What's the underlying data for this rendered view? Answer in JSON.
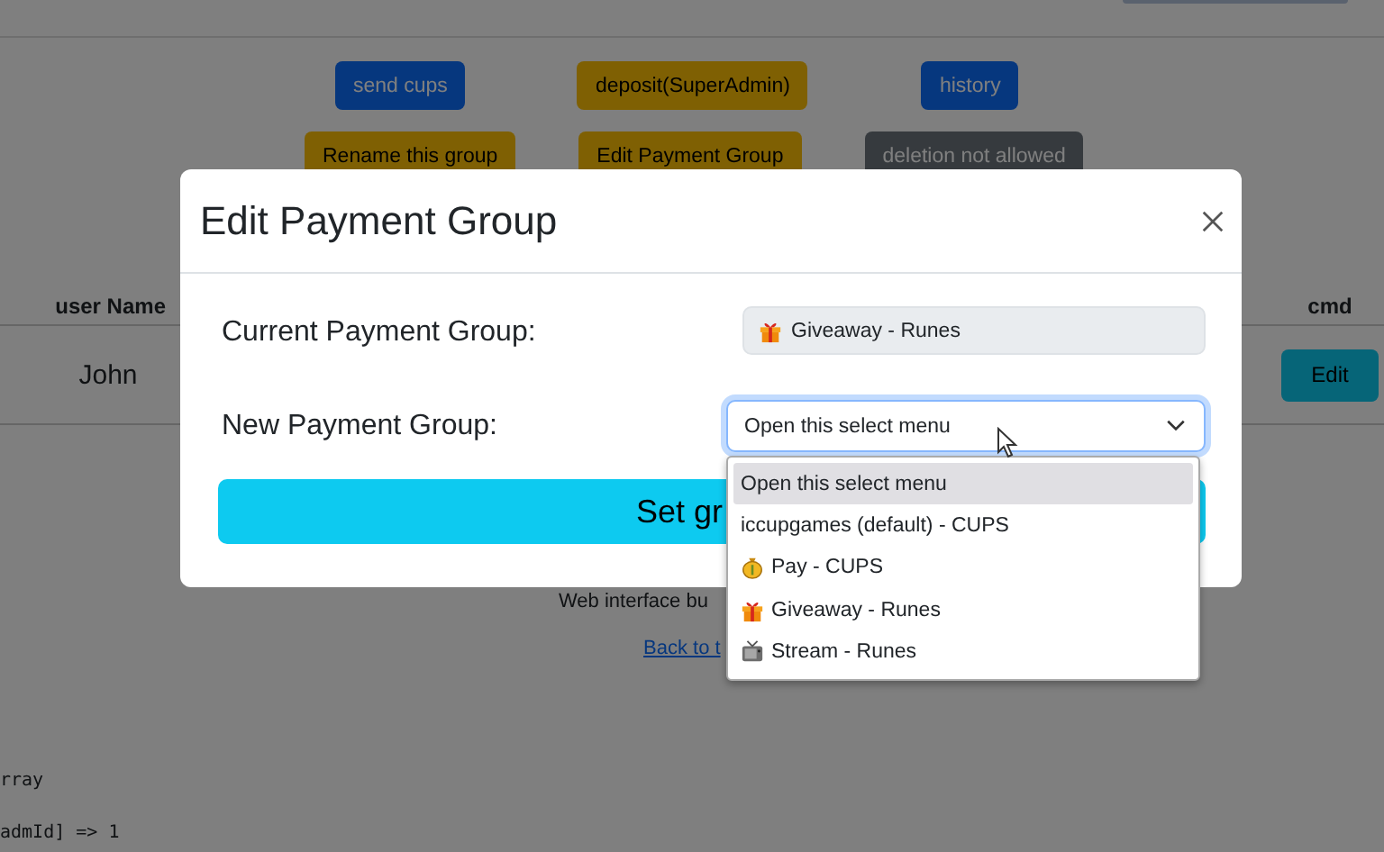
{
  "page": {
    "action_rows": [
      [
        {
          "label": "send cups",
          "kind": "primary"
        },
        {
          "label": "deposit(SuperAdmin)",
          "kind": "warning"
        },
        {
          "label": "history",
          "kind": "primary"
        }
      ],
      [
        {
          "label": "Rename this group",
          "kind": "warning"
        },
        {
          "label": "Edit Payment Group",
          "kind": "warning"
        },
        {
          "label": "deletion not allowed",
          "kind": "secondary"
        }
      ]
    ],
    "table": {
      "columns": [
        "user Name",
        "cmd"
      ],
      "rows": [
        {
          "user_name": "John",
          "cmd": "Edit"
        }
      ]
    },
    "footer": {
      "credit": "Web interface bu",
      "link": "Back to t"
    },
    "debug_lines": [
      "rray",
      "admId] => 1"
    ]
  },
  "modal": {
    "title": "Edit Payment Group",
    "current_label": "Current Payment Group:",
    "current_value": {
      "kind": "gift",
      "text": "Giveaway - Runes"
    },
    "new_label": "New Payment Group:",
    "select_value": "Open this select menu",
    "submit": "Set gr",
    "options": [
      {
        "text": "Open this select menu",
        "kind": "plain",
        "selected": true
      },
      {
        "text": "iccupgames (default) - CUPS",
        "kind": "plain",
        "selected": false
      },
      {
        "text": "Pay - CUPS",
        "kind": "money",
        "selected": false
      },
      {
        "text": "Giveaway - Runes",
        "kind": "gift",
        "selected": false
      },
      {
        "text": "Stream - Runes",
        "kind": "stream",
        "selected": false
      }
    ]
  }
}
